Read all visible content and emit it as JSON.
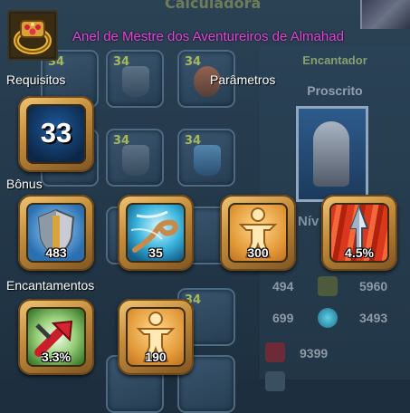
{
  "background": {
    "title": "Calculadora",
    "slot_levels": [
      "34",
      "34",
      "34",
      "34",
      "34",
      "34"
    ],
    "right_panel": {
      "title": "Encantador",
      "subtitle": "Proscrito",
      "level_label": "Nív",
      "stats": [
        {
          "value": "494",
          "icon": "agility-icon"
        },
        {
          "value": "5960",
          "icon": "body-icon"
        },
        {
          "value": "699",
          "icon": "spiral-icon"
        },
        {
          "value": "3493",
          "icon": "wave-icon"
        },
        {
          "value": "9399",
          "icon": "health-icon"
        }
      ]
    }
  },
  "tooltip": {
    "item_name": "Anel de Mestre dos Aventureiros de Almahad",
    "item_icon": "ring-icon",
    "requirements_label": "Requisitos",
    "parameters_label": "Parâmetros",
    "requirement_level": "33",
    "bonus_label": "Bônus",
    "bonuses": [
      {
        "icon": "shield-icon",
        "value": "483"
      },
      {
        "icon": "vortex-icon",
        "value": "35"
      },
      {
        "icon": "strength-figure-icon",
        "value": "300"
      },
      {
        "icon": "crystal-burst-icon",
        "value": "4.5%"
      }
    ],
    "enchantments_label": "Encantamentos",
    "enchantments": [
      {
        "icon": "crit-arrow-icon",
        "value": "3.3%"
      },
      {
        "icon": "strength-figure-icon",
        "value": "190"
      }
    ]
  },
  "colors": {
    "item_name": "#e443d8",
    "badge_gold": "#c58e3c",
    "background": "#1d2f3f"
  }
}
